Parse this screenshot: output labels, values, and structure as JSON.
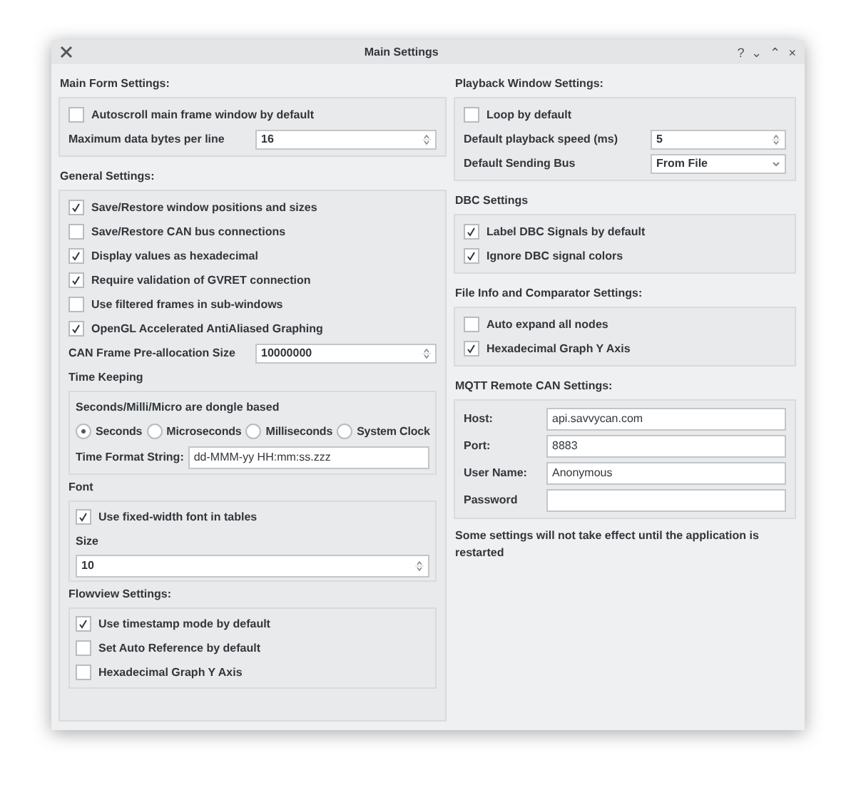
{
  "window": {
    "title": "Main Settings",
    "controls": [
      "?",
      "⌄",
      "⌃",
      "×"
    ]
  },
  "columns": [
    [
      {
        "title": "Main Form Settings:",
        "items": [
          {
            "kind": "checkbox",
            "label": "Autoscroll main frame window by default",
            "checked": false
          },
          {
            "kind": "spin",
            "label": "Maximum data bytes per line",
            "value": "16"
          }
        ]
      },
      {
        "title": "General Settings:",
        "items": [
          {
            "kind": "checkbox",
            "label": "Save/Restore window positions and sizes",
            "checked": true
          },
          {
            "kind": "checkbox",
            "label": "Save/Restore CAN bus connections",
            "checked": false
          },
          {
            "kind": "checkbox",
            "label": "Display values as hexadecimal",
            "checked": true
          },
          {
            "kind": "checkbox",
            "label": "Require validation of GVRET connection",
            "checked": true
          },
          {
            "kind": "checkbox",
            "label": "Use filtered frames in sub-windows",
            "checked": false
          },
          {
            "kind": "checkbox",
            "label": "OpenGL Accelerated AntiAliased Graphing",
            "checked": true
          },
          {
            "kind": "spin",
            "label": "CAN Frame Pre-allocation Size",
            "value": "10000000"
          },
          {
            "kind": "group",
            "title": "Time Keeping",
            "items": [
              {
                "kind": "label",
                "text": "Seconds/Milli/Micro are dongle based"
              },
              {
                "kind": "radios",
                "options": [
                  {
                    "label": "Seconds",
                    "selected": true
                  },
                  {
                    "label": "Microseconds",
                    "selected": false
                  },
                  {
                    "label": "Milliseconds",
                    "selected": false
                  },
                  {
                    "label": "System Clock",
                    "selected": false
                  }
                ]
              },
              {
                "kind": "field",
                "label": "Time Format String:",
                "value": "dd-MMM-yy HH:mm:ss.zzz"
              }
            ]
          },
          {
            "kind": "group",
            "title": "Font",
            "items": [
              {
                "kind": "checkbox",
                "label": "Use fixed-width font in tables",
                "checked": true
              },
              {
                "kind": "label",
                "text": "Size"
              },
              {
                "kind": "spin",
                "value": "10"
              }
            ]
          },
          {
            "kind": "group",
            "title": "Flowview Settings:",
            "items": [
              {
                "kind": "checkbox",
                "label": "Use timestamp mode by default",
                "checked": true
              },
              {
                "kind": "checkbox",
                "label": "Set Auto Reference by default",
                "checked": false
              },
              {
                "kind": "checkbox",
                "label": "Hexadecimal Graph Y Axis",
                "checked": false
              }
            ]
          }
        ]
      }
    ],
    [
      {
        "title": "Playback Window Settings:",
        "items": [
          {
            "kind": "checkbox",
            "label": "Loop by default",
            "checked": false
          },
          {
            "kind": "spin",
            "label": "Default playback speed (ms)",
            "value": "5"
          },
          {
            "kind": "combo",
            "label": "Default Sending Bus",
            "value": "From File"
          }
        ]
      },
      {
        "title": "DBC Settings",
        "items": [
          {
            "kind": "checkbox",
            "label": "Label DBC Signals by default",
            "checked": true
          },
          {
            "kind": "checkbox",
            "label": "Ignore DBC signal colors",
            "checked": true
          }
        ]
      },
      {
        "title": "File Info and Comparator Settings:",
        "items": [
          {
            "kind": "checkbox",
            "label": "Auto expand all nodes",
            "checked": false
          },
          {
            "kind": "checkbox",
            "label": "Hexadecimal Graph Y Axis",
            "checked": true
          }
        ]
      },
      {
        "title": "MQTT Remote CAN Settings:",
        "items": [
          {
            "kind": "field",
            "label": "Host:",
            "value": "api.savvycan.com"
          },
          {
            "kind": "field",
            "label": "Port:",
            "value": "8883"
          },
          {
            "kind": "field",
            "label": "User Name:",
            "value": "Anonymous"
          },
          {
            "kind": "field",
            "label": "Password",
            "value": ""
          }
        ]
      },
      {
        "kind": "note",
        "text": "Some settings will not take effect until the application is restarted"
      }
    ]
  ]
}
